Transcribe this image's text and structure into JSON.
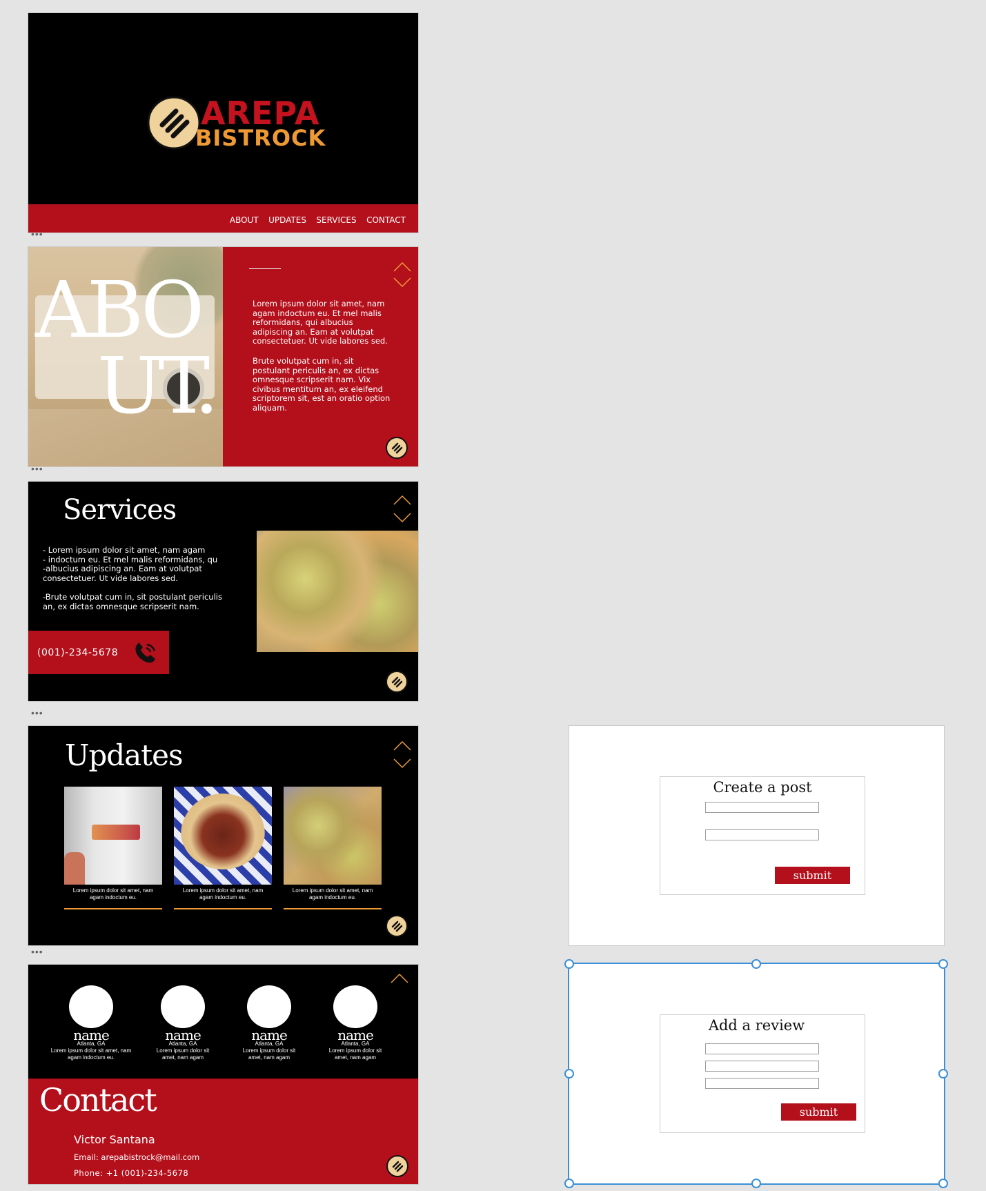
{
  "slide1": {
    "logo_line1": "AREPA",
    "logo_line2": "BISTROCK",
    "nav": [
      "ABOUT",
      "UPDATES",
      "SERVICES",
      "CONTACT"
    ]
  },
  "slide2": {
    "heading_line1": "ABO",
    "heading_line2": "UT.",
    "para1": "Lorem ipsum dolor sit amet, nam agam indoctum eu. Et mel malis reformidans, qui albucius adipiscing an. Eam at volutpat consectetuer. Ut vide labores sed.",
    "para2": "Brute volutpat cum in, sit postulant periculis an, ex dictas omnesque scripserit nam. Vix civibus mentitum an, ex eleifend scriptorem sit, est an oratio option aliquam."
  },
  "slide3": {
    "title": "Services",
    "bullets": [
      "- Lorem ipsum dolor sit amet, nam agam",
      "- indoctum eu. Et mel malis reformidans, qu",
      "-albucius adipiscing an. Eam at volutpat",
      "consectetuer. Ut vide labores sed."
    ],
    "para2": "-Brute volutpat cum in, sit postulant periculis an, ex dictas omnesque scripserit nam.",
    "phone": "(001)-234-5678"
  },
  "slide4": {
    "title": "Updates",
    "captions": [
      "Lorem ipsum dolor sit amet, nam agam indoctum eu.",
      "Lorem ipsum dolor sit amet, nam agam indoctum eu.",
      "Lorem ipsum dolor sit amet, nam agam indoctum eu."
    ]
  },
  "slide5": {
    "people": [
      {
        "name": "name",
        "location": "Atlanta, GA",
        "desc": "Lorem ipsum dolor sit amet, nam agam indoctum eu."
      },
      {
        "name": "name",
        "location": "Atlanta, GA",
        "desc": "Lorem ipsum dolor sit amet, nam agam"
      },
      {
        "name": "name",
        "location": "Atlanta, GA",
        "desc": "Lorem ipsum dolor sit amet, nam agam"
      },
      {
        "name": "name",
        "location": "Atlanta, GA",
        "desc": "Lorem ipsum dolor sit amet, nam agam"
      }
    ],
    "contact_title": "Contact",
    "contact_name": "Victor Santana",
    "email": "Email: arepabistrock@mail.com",
    "phone": "Phone: +1 (001)-234-5678"
  },
  "post_form": {
    "title": "Create a post",
    "submit": "submit"
  },
  "review_form": {
    "title": "Add a review",
    "submit": "submit"
  },
  "dots": "•••",
  "colors": {
    "brand_red": "#b3101c",
    "accent_orange": "#ee9a34",
    "badge_cream": "#f0d29c",
    "selection_blue": "#3b8fd6"
  }
}
